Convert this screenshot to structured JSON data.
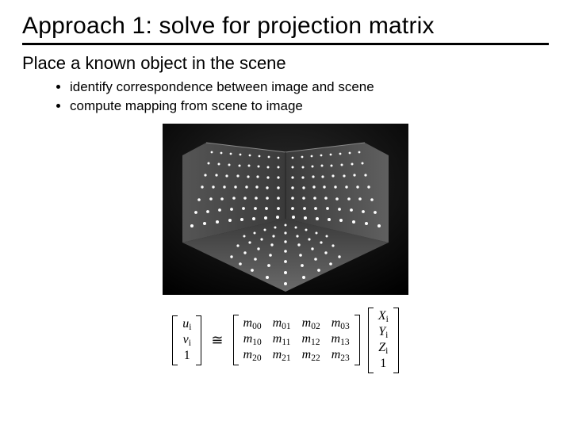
{
  "title": "Approach 1: solve for projection matrix",
  "subtitle": "Place a known object in the scene",
  "bullets": [
    "identify correspondence between image and scene",
    "compute mapping from scene to image"
  ],
  "figure_alt": "Photograph of a three-plane calibration target: two vertical boards meeting at a right angle on a horizontal base, each covered with a regular grid of white dots against a dark background.",
  "equation": {
    "lhs": [
      "u_i",
      "v_i",
      "1"
    ],
    "rel": "≅",
    "M": [
      [
        "m_00",
        "m_01",
        "m_02",
        "m_03"
      ],
      [
        "m_10",
        "m_11",
        "m_12",
        "m_13"
      ],
      [
        "m_20",
        "m_21",
        "m_22",
        "m_23"
      ]
    ],
    "rhs": [
      "X_i",
      "Y_i",
      "Z_i",
      "1"
    ]
  }
}
